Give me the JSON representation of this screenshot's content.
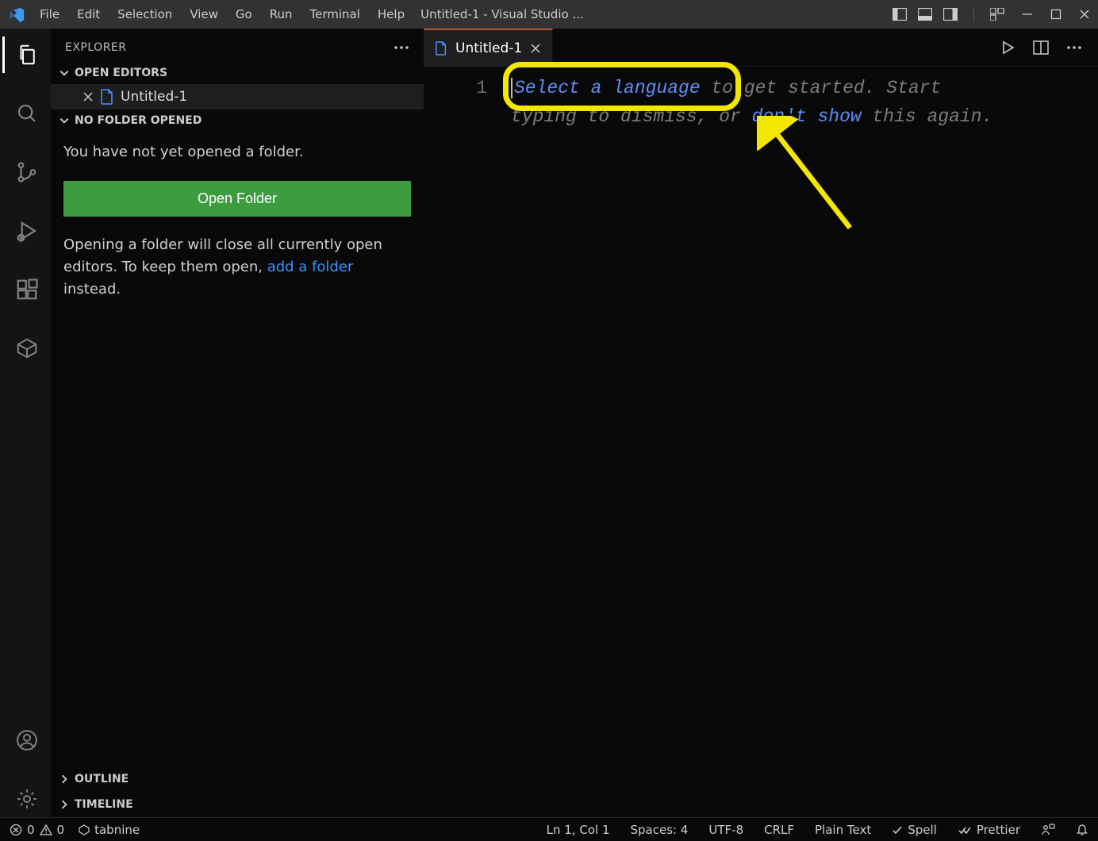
{
  "titlebar": {
    "menus": [
      "File",
      "Edit",
      "Selection",
      "View",
      "Go",
      "Run",
      "Terminal",
      "Help"
    ],
    "title": "Untitled-1 - Visual Studio ..."
  },
  "activitybar": {
    "top": [
      {
        "name": "explorer-icon",
        "active": true
      },
      {
        "name": "search-icon",
        "active": false
      },
      {
        "name": "source-control-icon",
        "active": false
      },
      {
        "name": "run-debug-icon",
        "active": false
      },
      {
        "name": "extensions-icon",
        "active": false
      },
      {
        "name": "package-icon",
        "active": false
      }
    ],
    "bottom": [
      {
        "name": "account-icon"
      },
      {
        "name": "settings-gear-icon"
      }
    ]
  },
  "sidebar": {
    "title": "EXPLORER",
    "sections": {
      "open_editors": "OPEN EDITORS",
      "no_folder": "NO FOLDER OPENED",
      "outline": "OUTLINE",
      "timeline": "TIMELINE"
    },
    "open_file": "Untitled-1",
    "no_folder_msg": "You have not yet opened a folder.",
    "open_folder_btn": "Open Folder",
    "hint_prefix": "Opening a folder will close all currently open editors. To keep them open, ",
    "hint_link": "add a folder",
    "hint_suffix": " instead."
  },
  "editor": {
    "tab_label": "Untitled-1",
    "line_number": "1",
    "hint": {
      "select_language": "Select a language",
      "mid1": " to get started. Start typing to dismiss, or ",
      "dont_show": "don't show",
      "mid2": " this again."
    }
  },
  "statusbar": {
    "errors": "0",
    "warnings": "0",
    "tabnine": "tabnine",
    "ln_col": "Ln 1, Col 1",
    "spaces": "Spaces: 4",
    "encoding": "UTF-8",
    "eol": "CRLF",
    "lang": "Plain Text",
    "spell": "Spell",
    "prettier": "Prettier"
  }
}
